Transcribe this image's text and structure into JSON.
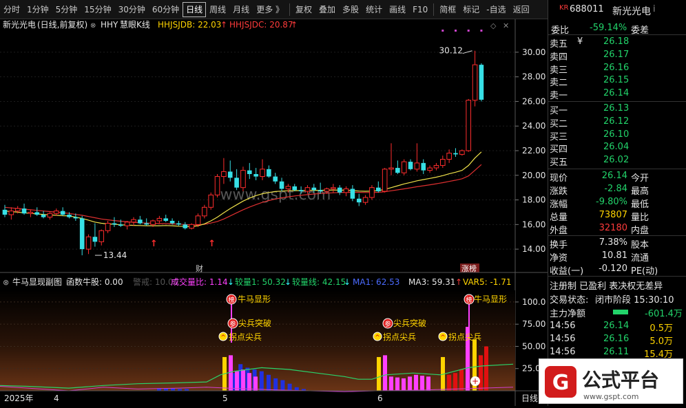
{
  "toolbar": {
    "items": [
      "分时",
      "1分钟",
      "5分钟",
      "15分钟",
      "30分钟",
      "60分钟",
      "日线",
      "周线",
      "月线",
      "更多 》",
      "复权",
      "叠加",
      "多股",
      "统计",
      "画线",
      "F10",
      "简框",
      "标记",
      "-自选",
      "返回"
    ],
    "active": "日线"
  },
  "main_header": {
    "stock": "新光光电",
    "mode": "(日线,前复权)",
    "indicator_code": "HHY",
    "indicator_name": "慧眼K线",
    "line1_label": "HHJSJDB: 22.03",
    "line1_arrow": "↑",
    "line2_label": "HHJSJDC: 20.87",
    "line2_arrow": "↑",
    "max_label": "30.12",
    "min_label": "13.44",
    "event_marker_cai": "财",
    "event_marker_bang": "涨榜",
    "watermark": "www.gspt.com",
    "y_ticks": [
      "30.00",
      "28.00",
      "26.00",
      "24.00",
      "22.00",
      "20.00",
      "18.00",
      "16.00",
      "14.00"
    ]
  },
  "sub_header": {
    "name": "牛马显现副图",
    "f1": "函数牛股: 0.00",
    "f2": "警戒: 10.00",
    "f3": "成交量比: 1.14",
    "f3_arrow": "↓",
    "f4": "较量1: 50.32",
    "f4_arrow": "↓",
    "f5": "较量线: 42.15",
    "f5_arrow": "↓",
    "f6": "MA1: 62.53",
    "f7": "MA3: 59.31",
    "f7_arrow": "↑",
    "f8": "VAR5: -1.71",
    "y_ticks": [
      "100.0",
      "75.00",
      "50.00",
      "25.00"
    ],
    "labels": {
      "bang": "榜",
      "nmxx": "牛马显形",
      "can": "参",
      "jbtp": "尖兵突破",
      "gdjb": "拐点尖兵"
    }
  },
  "xaxis": {
    "year": "2025年",
    "months": [
      "4",
      "5",
      "6"
    ],
    "period": "日线"
  },
  "quote": {
    "code_prefix": "KR",
    "code": "688011",
    "name": "新光光电",
    "info_icon": "i",
    "weibi_label": "委比",
    "weibi_value": "-59.14%",
    "weicha_label": "委差",
    "sell": [
      {
        "label": "卖五",
        "price": "26.18",
        "mark": "¥"
      },
      {
        "label": "卖四",
        "price": "26.17",
        "mark": ""
      },
      {
        "label": "卖三",
        "price": "26.16",
        "mark": ""
      },
      {
        "label": "卖二",
        "price": "26.15",
        "mark": ""
      },
      {
        "label": "卖一",
        "price": "26.14",
        "mark": ""
      }
    ],
    "buy": [
      {
        "label": "买一",
        "price": "26.13"
      },
      {
        "label": "买二",
        "price": "26.12"
      },
      {
        "label": "买三",
        "price": "26.10"
      },
      {
        "label": "买四",
        "price": "26.04"
      },
      {
        "label": "买五",
        "price": "26.02"
      }
    ],
    "stats": [
      {
        "l1": "现价",
        "v1": "26.14",
        "c1": "green",
        "l2": "今开"
      },
      {
        "l1": "涨跌",
        "v1": "-2.84",
        "c1": "green",
        "l2": "最高"
      },
      {
        "l1": "涨幅",
        "v1": "-9.80%",
        "c1": "green",
        "l2": "最低"
      },
      {
        "l1": "总量",
        "v1": "73807",
        "c1": "yellow",
        "l2": "量比"
      },
      {
        "l1": "外盘",
        "v1": "32180",
        "c1": "red",
        "l2": "内盘"
      }
    ],
    "stats2": [
      {
        "l1": "换手",
        "v1": "7.38%",
        "l2": "股本"
      },
      {
        "l1": "净资",
        "v1": "10.81",
        "l2": "流通"
      },
      {
        "l1": "收益(一)",
        "v1": "-0.120",
        "l2": "PE(动)"
      }
    ],
    "reg_line": "注册制 已盈利 表决权无差异",
    "trade_state_label": "交易状态:",
    "trade_state": "闭市阶段 15:30:10",
    "net_flow_label": "主力净额",
    "net_flow_value": "-601.4万",
    "ticks": [
      {
        "time": "14:56",
        "price": "26.14",
        "vol": "0.5万"
      },
      {
        "time": "14:56",
        "price": "26.16",
        "vol": "5.0万"
      },
      {
        "time": "14:56",
        "price": "26.11",
        "vol": "15.4万"
      },
      {
        "time": "14:56",
        "price": "26.13",
        "vol": "6.3万"
      }
    ]
  },
  "logo": {
    "text": "公式平台",
    "url_text": "www.gspt.com"
  },
  "chart_data": {
    "type": "candlestick",
    "y_range": [
      13.0,
      31.0
    ],
    "candles": [
      [
        17.2,
        17.6,
        16.6,
        16.8
      ],
      [
        16.8,
        17.4,
        16.4,
        17.1
      ],
      [
        17.1,
        17.5,
        16.9,
        17.3
      ],
      [
        17.3,
        17.7,
        16.8,
        16.9
      ],
      [
        16.9,
        17.2,
        16.6,
        17.0
      ],
      [
        17.0,
        17.4,
        16.7,
        16.8
      ],
      [
        16.8,
        17.1,
        16.5,
        16.6
      ],
      [
        16.6,
        17.0,
        16.4,
        16.9
      ],
      [
        16.9,
        17.3,
        16.7,
        17.1
      ],
      [
        17.1,
        17.4,
        16.7,
        16.8
      ],
      [
        16.8,
        17.0,
        16.5,
        16.6
      ],
      [
        16.6,
        16.9,
        16.3,
        16.5
      ],
      [
        16.5,
        16.7,
        13.5,
        14.0
      ],
      [
        14.0,
        15.2,
        13.6,
        15.0
      ],
      [
        15.0,
        16.1,
        14.2,
        14.6
      ],
      [
        14.6,
        15.6,
        14.3,
        15.5
      ],
      [
        15.5,
        16.3,
        15.3,
        16.1
      ],
      [
        16.1,
        16.6,
        15.8,
        16.0
      ],
      [
        16.0,
        16.4,
        15.8,
        15.9
      ],
      [
        15.9,
        16.3,
        15.6,
        16.2
      ],
      [
        16.2,
        16.6,
        15.9,
        16.4
      ],
      [
        16.4,
        16.7,
        16.0,
        16.1
      ],
      [
        16.1,
        16.5,
        15.9,
        16.0
      ],
      [
        16.0,
        16.4,
        15.8,
        16.3
      ],
      [
        16.3,
        16.7,
        16.1,
        16.5
      ],
      [
        16.5,
        16.8,
        16.2,
        16.3
      ],
      [
        16.3,
        16.5,
        16.0,
        16.1
      ],
      [
        16.1,
        16.3,
        15.9,
        16.0
      ],
      [
        16.0,
        16.2,
        15.6,
        15.7
      ],
      [
        15.7,
        16.1,
        15.6,
        16.0
      ],
      [
        16.0,
        16.9,
        15.8,
        16.7
      ],
      [
        16.7,
        17.6,
        16.5,
        17.4
      ],
      [
        17.4,
        18.6,
        17.2,
        18.4
      ],
      [
        18.4,
        20.1,
        18.2,
        19.9
      ],
      [
        19.9,
        21.4,
        19.3,
        20.3
      ],
      [
        20.3,
        21.2,
        19.5,
        19.8
      ],
      [
        19.8,
        20.5,
        18.8,
        19.0
      ],
      [
        19.0,
        20.7,
        18.7,
        20.4
      ],
      [
        20.4,
        21.0,
        19.7,
        20.1
      ],
      [
        20.1,
        20.6,
        19.6,
        19.9
      ],
      [
        19.9,
        21.3,
        19.6,
        20.5
      ],
      [
        20.5,
        20.8,
        19.8,
        19.9
      ],
      [
        19.9,
        20.2,
        19.3,
        19.5
      ],
      [
        19.5,
        19.8,
        18.7,
        18.9
      ],
      [
        18.9,
        19.3,
        18.6,
        19.1
      ],
      [
        19.1,
        19.3,
        18.7,
        18.8
      ],
      [
        18.8,
        19.1,
        18.5,
        18.7
      ],
      [
        18.7,
        19.2,
        18.5,
        19.0
      ],
      [
        19.0,
        19.3,
        18.6,
        18.8
      ],
      [
        18.8,
        19.4,
        18.5,
        18.7
      ],
      [
        18.7,
        19.0,
        18.5,
        18.9
      ],
      [
        18.9,
        19.3,
        18.6,
        19.0
      ],
      [
        19.0,
        19.2,
        18.4,
        18.6
      ],
      [
        18.6,
        19.1,
        18.3,
        18.9
      ],
      [
        18.9,
        19.2,
        17.9,
        18.1
      ],
      [
        18.1,
        18.5,
        17.5,
        17.8
      ],
      [
        17.8,
        18.4,
        17.6,
        18.2
      ],
      [
        18.2,
        19.2,
        18.0,
        19.0
      ],
      [
        19.0,
        19.5,
        18.6,
        18.7
      ],
      [
        18.7,
        20.6,
        18.6,
        20.5
      ],
      [
        20.5,
        22.6,
        20.0,
        20.6
      ],
      [
        20.6,
        21.2,
        20.1,
        20.2
      ],
      [
        20.2,
        21.3,
        20.0,
        21.1
      ],
      [
        21.1,
        21.3,
        20.4,
        20.5
      ],
      [
        20.5,
        22.6,
        20.3,
        21.0
      ],
      [
        21.0,
        21.3,
        20.1,
        20.4
      ],
      [
        20.4,
        20.8,
        20.2,
        20.6
      ],
      [
        20.6,
        21.0,
        20.4,
        20.8
      ],
      [
        20.8,
        21.6,
        20.6,
        21.3
      ],
      [
        21.3,
        22.1,
        21.0,
        21.8
      ],
      [
        21.8,
        22.2,
        21.5,
        21.7
      ],
      [
        21.7,
        22.1,
        21.6,
        22.0
      ],
      [
        22.0,
        26.2,
        21.9,
        26.1
      ],
      [
        26.1,
        30.12,
        25.6,
        28.98
      ],
      [
        28.98,
        29.1,
        26.0,
        26.14
      ]
    ],
    "ma_yellow": [
      17.1,
      17.05,
      17.0,
      16.95,
      16.9,
      16.86,
      16.82,
      16.78,
      16.75,
      16.72,
      16.7,
      16.6,
      16.5,
      16.35,
      16.2,
      16.1,
      16.05,
      16.02,
      15.98,
      15.95,
      15.93,
      15.92,
      15.9,
      15.9,
      15.9,
      15.92,
      15.9,
      15.86,
      15.85,
      15.83,
      15.9,
      16.05,
      16.3,
      16.6,
      16.95,
      17.3,
      17.6,
      17.9,
      18.15,
      18.35,
      18.5,
      18.6,
      18.68,
      18.72,
      18.74,
      18.75,
      18.76,
      18.77,
      18.78,
      18.78,
      18.79,
      18.8,
      18.79,
      18.79,
      18.76,
      18.72,
      18.7,
      18.72,
      18.76,
      18.85,
      19.0,
      19.15,
      19.3,
      19.42,
      19.55,
      19.65,
      19.75,
      19.85,
      19.97,
      20.12,
      20.25,
      20.4,
      20.8,
      21.4,
      21.9
    ],
    "ma_red": [
      17.4,
      17.35,
      17.3,
      17.25,
      17.2,
      17.15,
      17.1,
      17.05,
      17.0,
      16.95,
      16.9,
      16.82,
      16.75,
      16.65,
      16.55,
      16.45,
      16.38,
      16.32,
      16.27,
      16.22,
      16.18,
      16.15,
      16.12,
      16.1,
      16.08,
      16.07,
      16.05,
      16.03,
      16.0,
      15.97,
      15.97,
      16.02,
      16.12,
      16.25,
      16.45,
      16.7,
      16.95,
      17.2,
      17.42,
      17.62,
      17.8,
      17.95,
      18.07,
      18.17,
      18.25,
      18.32,
      18.38,
      18.43,
      18.48,
      18.52,
      18.55,
      18.58,
      18.6,
      18.62,
      18.62,
      18.61,
      18.6,
      18.6,
      18.62,
      18.67,
      18.74,
      18.82,
      18.9,
      18.98,
      19.07,
      19.15,
      19.23,
      19.31,
      19.4,
      19.5,
      19.6,
      19.72,
      19.95,
      20.4,
      20.87
    ]
  }
}
